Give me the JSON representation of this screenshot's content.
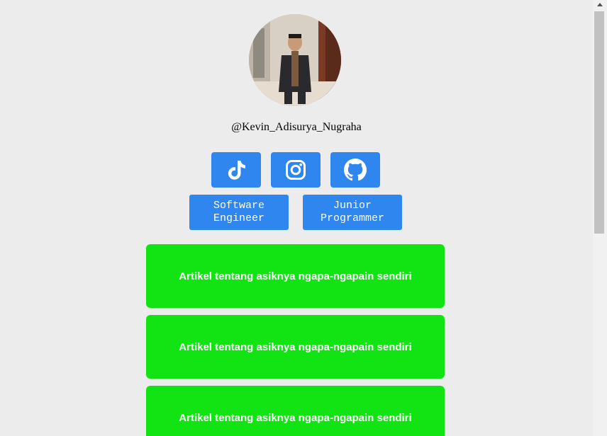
{
  "profile": {
    "username": "@Kevin_Adisurya_Nugraha",
    "avatar_icon": "profile-photo"
  },
  "social_links": [
    {
      "name": "tiktok",
      "icon": "tiktok-icon"
    },
    {
      "name": "instagram",
      "icon": "instagram-icon"
    },
    {
      "name": "github",
      "icon": "github-icon"
    }
  ],
  "tags": [
    {
      "label": "Software\nEngineer"
    },
    {
      "label": "Junior\nProgrammer"
    }
  ],
  "cards": [
    {
      "title": "Artikel tentang asiknya ngapa-ngapain sendiri"
    },
    {
      "title": "Artikel tentang asiknya ngapa-ngapain sendiri"
    },
    {
      "title": "Artikel tentang asiknya ngapa-ngapain sendiri"
    }
  ],
  "colors": {
    "background": "#ececec",
    "button_blue": "#2e86ee",
    "card_green": "#12e414",
    "text_white": "#ffffff"
  }
}
